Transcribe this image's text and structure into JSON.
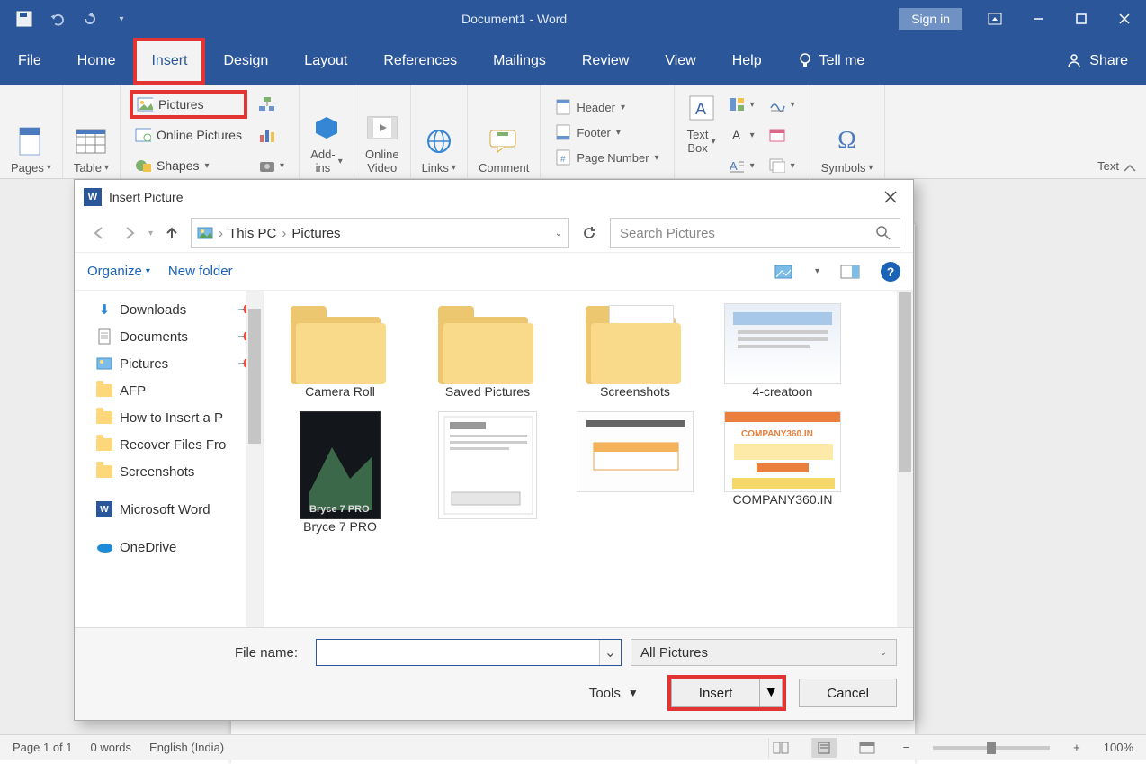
{
  "titlebar": {
    "title": "Document1  -  Word",
    "signin": "Sign in"
  },
  "tabs": {
    "file": "File",
    "home": "Home",
    "insert": "Insert",
    "design": "Design",
    "layout": "Layout",
    "references": "References",
    "mailings": "Mailings",
    "review": "Review",
    "view": "View",
    "help": "Help",
    "tellme": "Tell me",
    "share": "Share"
  },
  "ribbon": {
    "pages": "Pages",
    "table": "Table",
    "pictures": "Pictures",
    "online_pictures": "Online Pictures",
    "shapes": "Shapes",
    "addins": "Add-\nins",
    "online_video": "Online\nVideo",
    "links": "Links",
    "comment": "Comment",
    "header": "Header",
    "footer": "Footer",
    "page_number": "Page Number",
    "text_box": "Text\nBox",
    "text_label_right": "Text",
    "symbols": "Symbols"
  },
  "dialog": {
    "title": "Insert Picture",
    "crumb1": "This PC",
    "crumb2": "Pictures",
    "search_placeholder": "Search Pictures",
    "organize": "Organize",
    "new_folder": "New folder",
    "tree": {
      "downloads": "Downloads",
      "documents": "Documents",
      "pictures": "Pictures",
      "afp": "AFP",
      "howto": "How to Insert a P",
      "recover": "Recover Files Fro",
      "screenshots": "Screenshots",
      "word": "Microsoft Word",
      "onedrive": "OneDrive"
    },
    "files": {
      "f1": "Camera Roll",
      "f2": "Saved Pictures",
      "f3": "Screenshots",
      "f4": "4-creatoon",
      "f5": "Bryce 7 PRO",
      "f6": "",
      "f7": "",
      "f8": "COMPANY360.IN"
    },
    "file_name_label": "File name:",
    "filter": "All Pictures",
    "tools": "Tools",
    "insert_btn": "Insert",
    "cancel_btn": "Cancel"
  },
  "status": {
    "page": "Page 1 of 1",
    "words": "0 words",
    "lang": "English (India)",
    "zoom": "100%"
  }
}
